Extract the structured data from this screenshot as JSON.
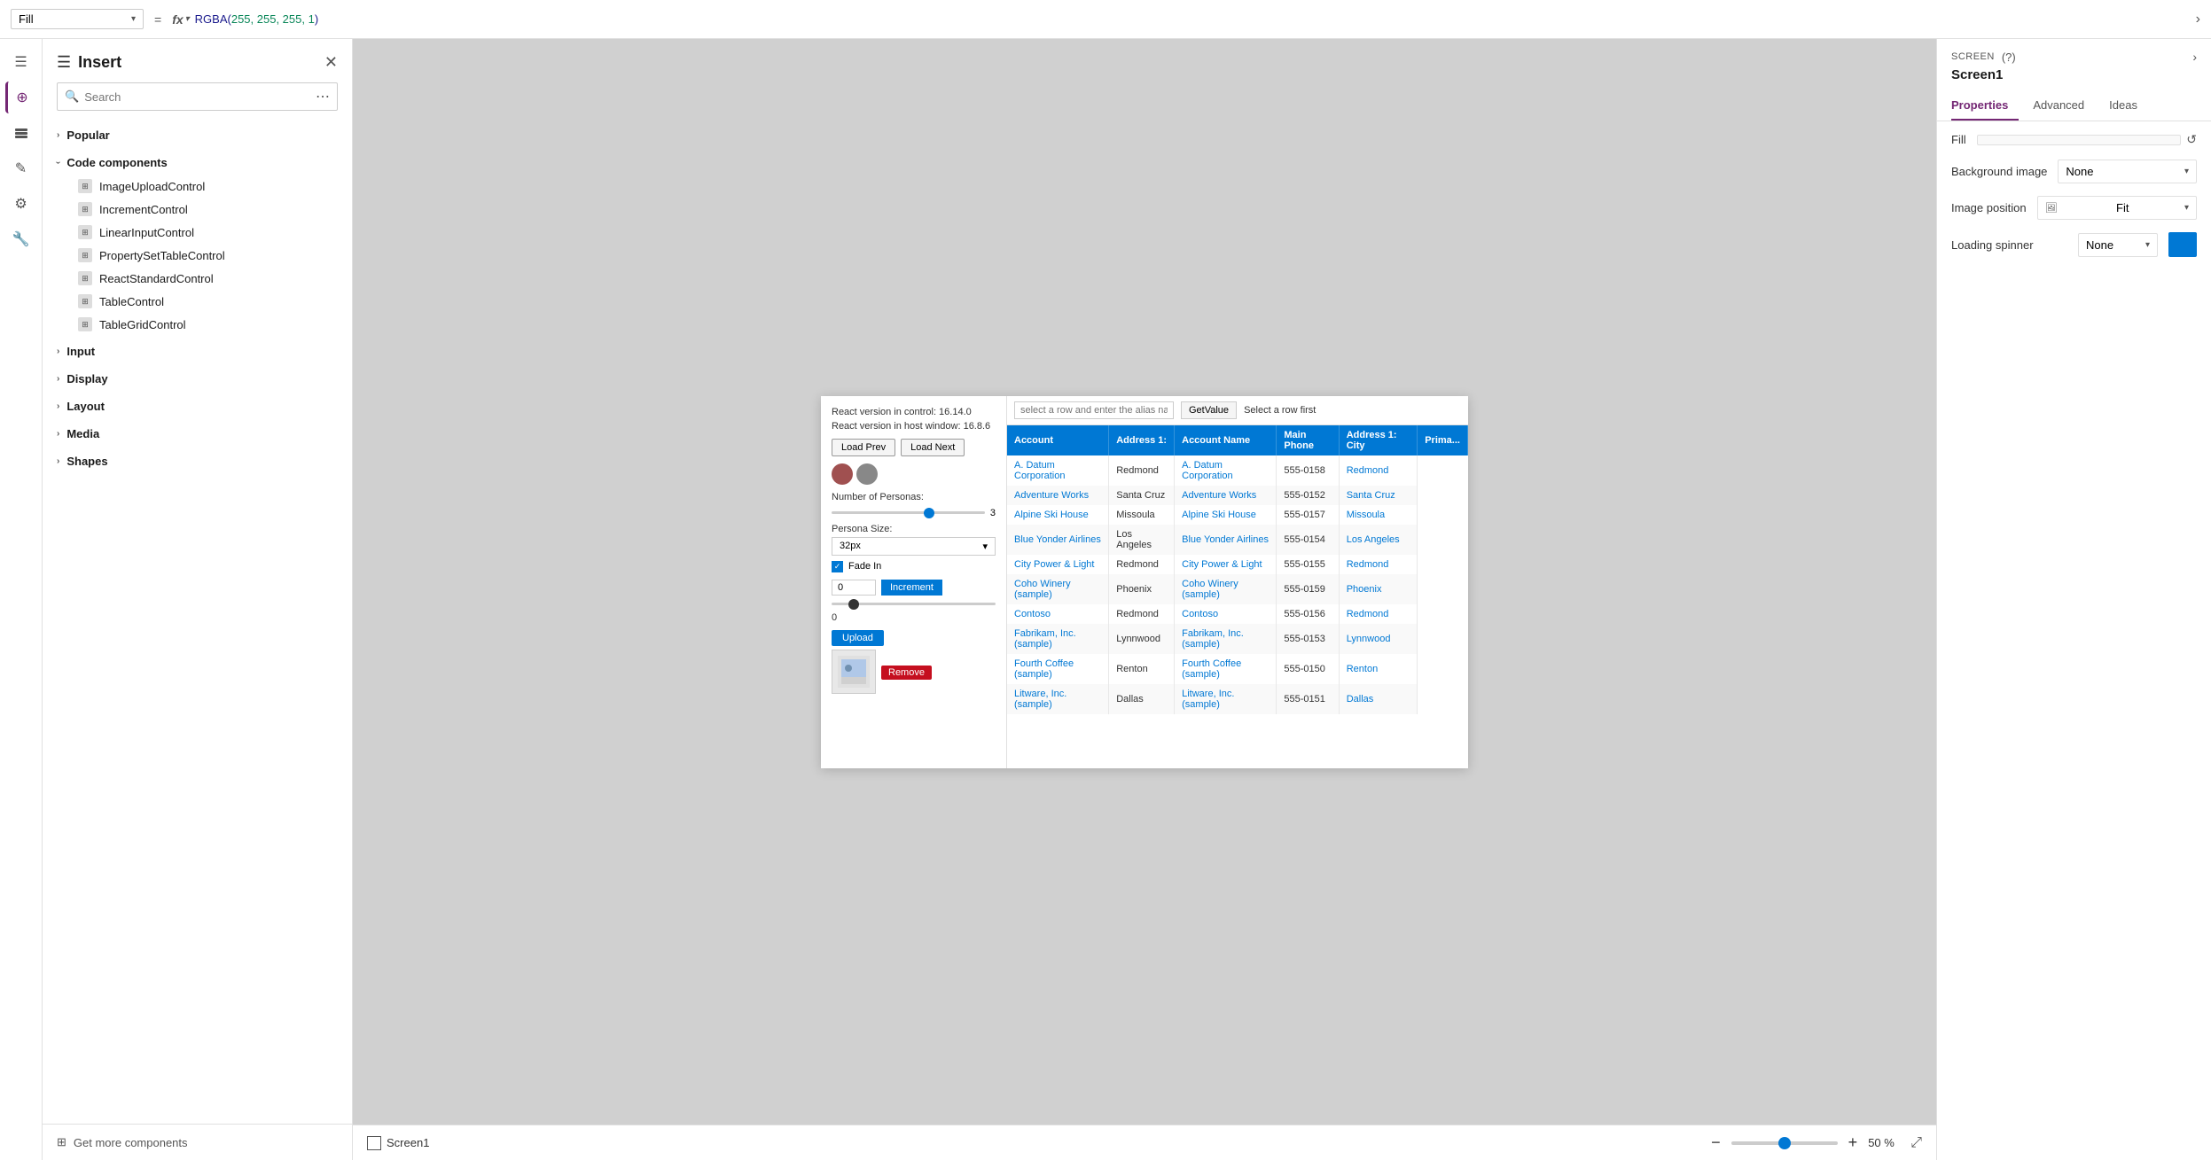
{
  "topbar": {
    "fill_label": "Fill",
    "equals": "=",
    "fx_label": "fx",
    "formula": "RGBA(255, 255, 255, 1)",
    "formula_rgba": "RGBA(",
    "formula_nums": "255, 255, 255, 1",
    "formula_close": ")"
  },
  "sidebar": {
    "icons": [
      "≡",
      "⊕",
      "⬜",
      "✏",
      "⚙",
      "🔧"
    ]
  },
  "insert_panel": {
    "title": "Insert",
    "search_placeholder": "Search",
    "more_icon": "⋯",
    "sections": [
      {
        "label": "Popular",
        "expanded": false,
        "children": []
      },
      {
        "label": "Code components",
        "expanded": true,
        "children": [
          "ImageUploadControl",
          "IncrementControl",
          "LinearInputControl",
          "PropertySetTableControl",
          "ReactStandardControl",
          "TableControl",
          "TableGridControl"
        ]
      },
      {
        "label": "Input",
        "expanded": false,
        "children": []
      },
      {
        "label": "Display",
        "expanded": false,
        "children": []
      },
      {
        "label": "Layout",
        "expanded": false,
        "children": []
      },
      {
        "label": "Media",
        "expanded": false,
        "children": []
      },
      {
        "label": "Shapes",
        "expanded": false,
        "children": []
      }
    ],
    "bottom_link": "Get more components"
  },
  "canvas": {
    "react_version_control": "React version in control: 16.14.0",
    "react_version_host": "React version in host window: 16.8.6",
    "load_prev": "Load Prev",
    "load_next": "Load Next",
    "num_personas_label": "Number of Personas:",
    "slider_value": "3",
    "persona_size_label": "Persona Size:",
    "persona_size_value": "32px",
    "fade_in_label": "Fade In",
    "increment_value": "0",
    "increment_btn": "Increment",
    "range_value": "0",
    "upload_btn": "Upload",
    "remove_btn": "Remove",
    "alias_placeholder": "select a row and enter the alias name",
    "get_value_btn": "GetValue",
    "select_row_text": "Select a row first",
    "table_headers": [
      "Account",
      "Address 1:",
      "Account Name",
      "Main Phone",
      "Address 1: City",
      "Prima..."
    ],
    "table_rows": [
      [
        "A. Datum Corporation",
        "Redmond",
        "A. Datum Corporation",
        "555-0158",
        "Redmond"
      ],
      [
        "Adventure Works",
        "Santa Cruz",
        "Adventure Works",
        "555-0152",
        "Santa Cruz"
      ],
      [
        "Alpine Ski House",
        "Missoula",
        "Alpine Ski House",
        "555-0157",
        "Missoula"
      ],
      [
        "Blue Yonder Airlines",
        "Los Angeles",
        "Blue Yonder Airlines",
        "555-0154",
        "Los Angeles"
      ],
      [
        "City Power & Light",
        "Redmond",
        "City Power & Light",
        "555-0155",
        "Redmond"
      ],
      [
        "Coho Winery (sample)",
        "Phoenix",
        "Coho Winery (sample)",
        "555-0159",
        "Phoenix"
      ],
      [
        "Contoso",
        "Redmond",
        "Contoso",
        "555-0156",
        "Redmond"
      ],
      [
        "Fabrikam, Inc. (sample)",
        "Lynnwood",
        "Fabrikam, Inc. (sample)",
        "555-0153",
        "Lynnwood"
      ],
      [
        "Fourth Coffee (sample)",
        "Renton",
        "Fourth Coffee (sample)",
        "555-0150",
        "Renton"
      ],
      [
        "Litware, Inc. (sample)",
        "Dallas",
        "Litware, Inc. (sample)",
        "555-0151",
        "Dallas"
      ]
    ]
  },
  "bottom_bar": {
    "screen_name": "Screen1",
    "zoom_minus": "−",
    "zoom_plus": "+",
    "zoom_value": "50 %"
  },
  "right_panel": {
    "screen_label": "SCREEN",
    "screen_name": "Screen1",
    "tabs": [
      "Properties",
      "Advanced",
      "Ideas"
    ],
    "active_tab": "Properties",
    "fill_label": "Fill",
    "background_image_label": "Background image",
    "background_image_value": "None",
    "image_position_label": "Image position",
    "image_position_value": "Fit",
    "loading_spinner_label": "Loading spinner",
    "loading_spinner_value": "None",
    "loading_spinner_color": "#0078d4"
  }
}
